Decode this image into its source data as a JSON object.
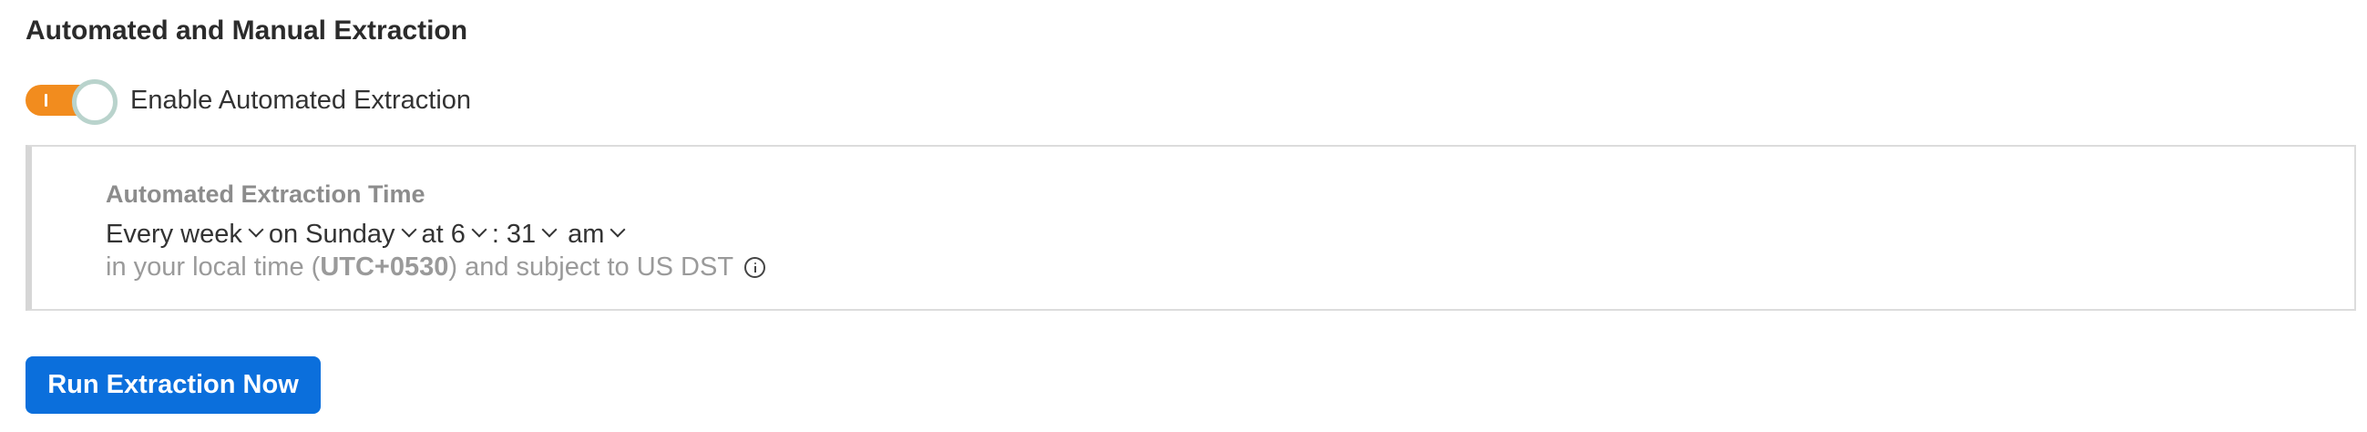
{
  "section": {
    "title": "Automated and Manual Extraction"
  },
  "toggle": {
    "label": "Enable Automated Extraction",
    "enabled": true,
    "accent_color": "#f28c1e"
  },
  "schedule": {
    "title": "Automated Extraction Time",
    "frequency": "Every week",
    "on_text": "on",
    "day": "Sunday",
    "at_text": "at",
    "hour": "6",
    "separator": ":",
    "minute": "31",
    "meridiem": "am",
    "tz_prefix": "in your local time (",
    "tz_value": "UTC+0530",
    "tz_suffix": ") and subject to US DST",
    "info_icon": "info-circle-icon"
  },
  "actions": {
    "run_label": "Run Extraction Now",
    "run_color": "#0b6fdc"
  }
}
